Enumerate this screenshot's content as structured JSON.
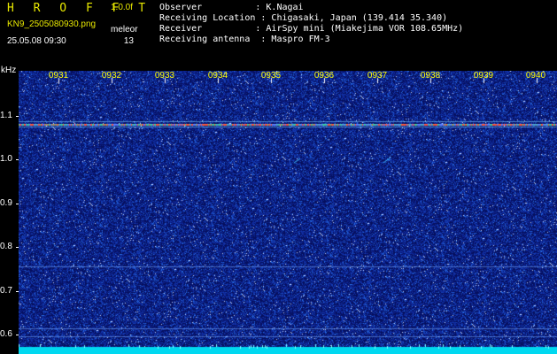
{
  "header": {
    "app_title": "H R O F F T",
    "version": "1.0.0f",
    "filename": "KN9_2505080930.png",
    "meteor_label": "meleor",
    "datetime": "25.05.08 09:30",
    "count": "13",
    "info_lines": [
      "Observer          : K.Nagai",
      "Receiving Location : Chigasaki, Japan (139.414 35.340)",
      "Receiver          : AirSpy mini (Miakejima VOR 108.65MHz)",
      "Receiving antenna  : Maspro FM-3"
    ]
  },
  "y_axis": {
    "unit": "kHz",
    "ticks": [
      "1.1",
      "1.0",
      "0.9",
      "0.8",
      "0.7",
      "0.6"
    ]
  },
  "x_axis": {
    "ticks": [
      "0931",
      "0932",
      "0933",
      "0934",
      "0935",
      "0936",
      "0937",
      "0938",
      "0939",
      "0940"
    ]
  },
  "colors": {
    "header_title": "#e8e800",
    "time_labels": "#ffff00",
    "background": "#000000",
    "spectrogram_base": "#0a1a8a",
    "carrier_line": "#ff5a3c",
    "floor_band": "#00e5ff"
  }
}
